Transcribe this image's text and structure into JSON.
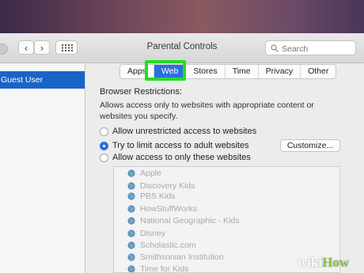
{
  "window": {
    "title": "Parental Controls"
  },
  "toolbar": {
    "back": "‹",
    "forward": "›",
    "search_placeholder": "Search"
  },
  "sidebar": {
    "items": [
      {
        "label": "Guest User"
      }
    ]
  },
  "tabs": [
    {
      "label": "Apps"
    },
    {
      "label": "Web",
      "active": true
    },
    {
      "label": "Stores"
    },
    {
      "label": "Time"
    },
    {
      "label": "Privacy"
    },
    {
      "label": "Other"
    }
  ],
  "web": {
    "heading": "Browser Restrictions:",
    "description": "Allows access only to websites with appropriate content or websites you specify.",
    "options": [
      {
        "label": "Allow unrestricted access to websites",
        "selected": false
      },
      {
        "label": "Try to limit access to adult websites",
        "selected": true
      },
      {
        "label": "Allow access to only these websites",
        "selected": false
      }
    ],
    "customize_label": "Customize...",
    "sites": [
      "Apple",
      "Discovery Kids",
      "PBS Kids",
      "HowStuffWorks",
      "National Geographic - Kids",
      "Disney",
      "Scholastic.com",
      "Smithsonian Institution",
      "Time for Kids"
    ]
  },
  "watermark": {
    "wiki": "wiki",
    "how": "How"
  },
  "colors": {
    "accent": "#2a6fe0",
    "selection": "#1a63c6",
    "highlight": "#22dd22"
  }
}
